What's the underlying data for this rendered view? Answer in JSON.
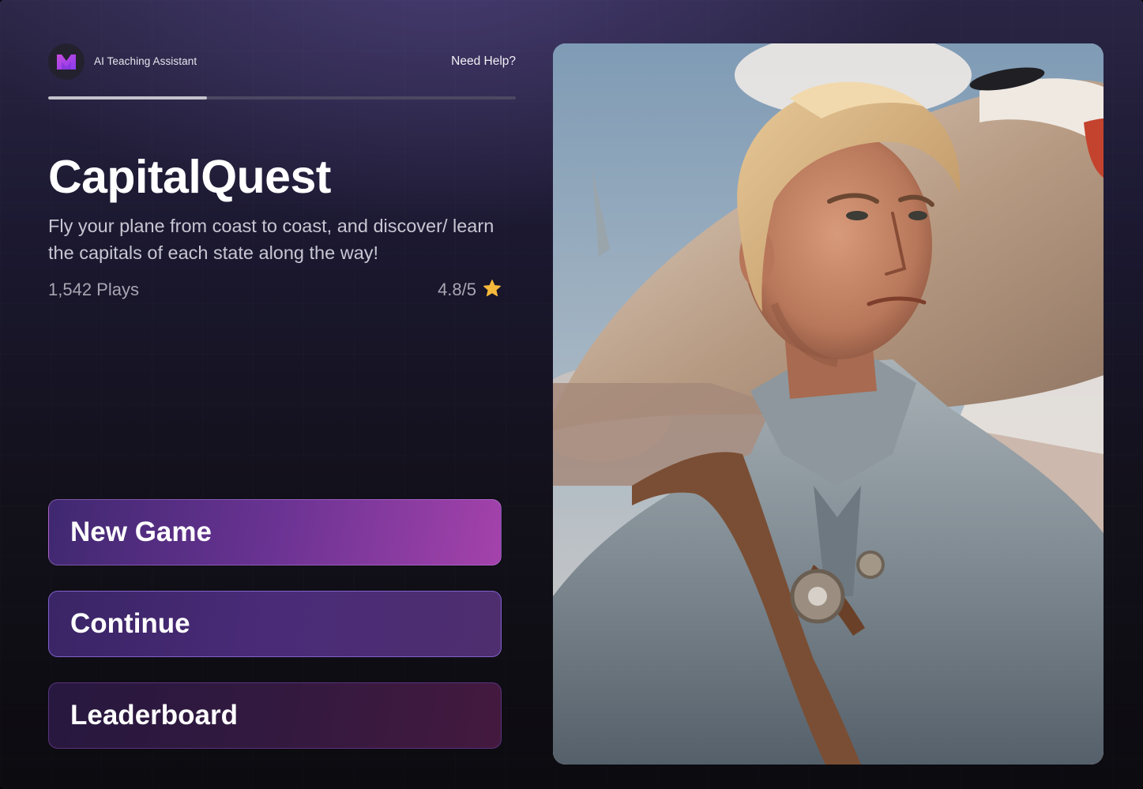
{
  "header": {
    "brand_label": "AI Teaching Assistant",
    "help_label": "Need Help?",
    "logo_icon": "m-logo-icon",
    "progress_fraction": 0.34
  },
  "game": {
    "title": "CapitalQuest",
    "description": "Fly your plane from coast to coast, and discover/ learn the capitals of each state along the way!",
    "plays": "1,542 Plays",
    "rating": "4.8/5",
    "rating_icon": "star-icon"
  },
  "buttons": {
    "new_game": "New Game",
    "continue": "Continue",
    "leaderboard": "Leaderboard"
  },
  "hero": {
    "image_subject": "painted pilot portrait in front of airplane"
  },
  "colors": {
    "accent_purple": "#a442ab",
    "star": "#f6b93b",
    "background": "#121019"
  }
}
